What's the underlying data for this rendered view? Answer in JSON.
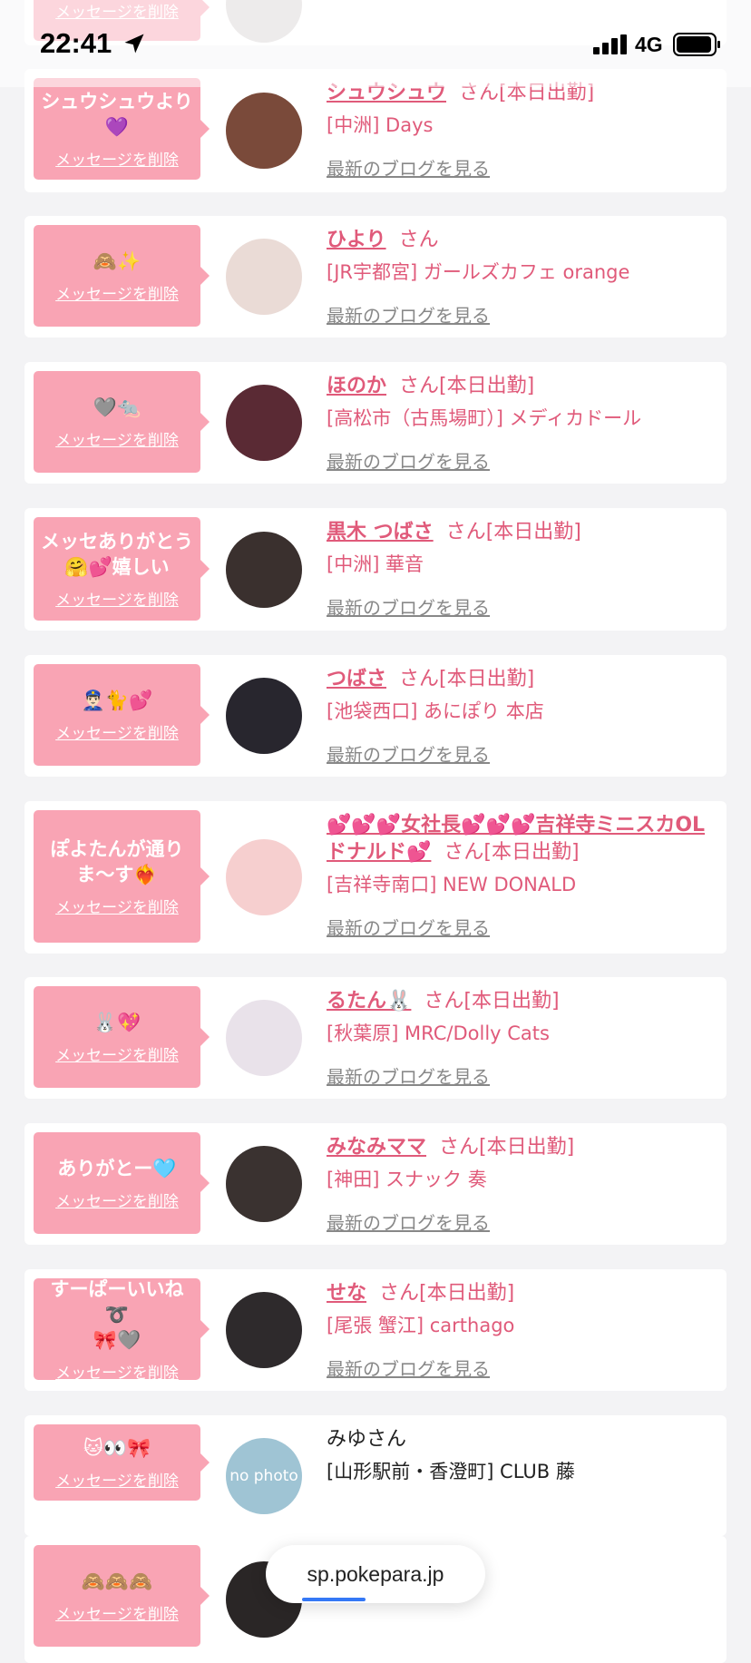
{
  "status_bar": {
    "time": "22:41",
    "network": "4G"
  },
  "common": {
    "delete_label": "メッセージを削除",
    "blog_label": "最新のブログを見る",
    "honorific": "さん"
  },
  "rows": [
    {
      "message": "",
      "name": "",
      "status": "",
      "shop": "",
      "avatar": "#d8d2d2"
    },
    {
      "message": "シュウシュウより\n💜",
      "name": "シュウシュウ",
      "status": "[本日出勤]",
      "shop": "[中洲] Days",
      "avatar": "#7a4a3a"
    },
    {
      "message": "🙈✨",
      "name": "ひより",
      "status": "",
      "shop": "[JR宇都宮] ガールズカフェ orange",
      "avatar": "#eadbd6"
    },
    {
      "message": "🩶🐀",
      "name": "ほのか",
      "status": "[本日出勤]",
      "shop": "[高松市（古馬場町）] メディカドール",
      "avatar": "#5a2a34"
    },
    {
      "message": "メッセありがとう\n🤗💕嬉しい",
      "name": "黒木 つばさ",
      "status": "[本日出勤]",
      "shop": "[中洲] 華音",
      "avatar": "#3a302e"
    },
    {
      "message": "👮🏻‍♂️🐈💕",
      "name": "つばさ",
      "status": "[本日出勤]",
      "shop": "[池袋西口] あにぽり 本店",
      "avatar": "#28262e"
    },
    {
      "message": "ぽよたんが通り\nま〜す❤️‍🔥",
      "name": "💕💕💕女社長💕💕💕吉祥寺ミニスカOLドナルド💕",
      "status": "[本日出勤]",
      "shop": "[吉祥寺南口] NEW DONALD",
      "avatar": "#f6cfcf"
    },
    {
      "message": "🐰💖",
      "name": "るたん🐰",
      "status": "[本日出勤]",
      "shop": "[秋葉原] MRC/Dolly Cats",
      "avatar": "#e9e2ea"
    },
    {
      "message": "ありがとー🩵",
      "name": "みなみママ",
      "status": "[本日出勤]",
      "shop": "[神田] スナック 奏",
      "avatar": "#3a3230"
    },
    {
      "message": "すーぱーいいね➰\n🎀🩶",
      "name": "せな",
      "status": "[本日出勤]",
      "shop": "[尾張 蟹江] carthago",
      "avatar": "#2e2a2c"
    },
    {
      "message": "🐱👀🎀",
      "name": "みゆさん",
      "status": "",
      "shop": "[山形駅前・香澄町] CLUB 藤",
      "avatar": "#9fc4d4",
      "avatar_text": "no photo"
    },
    {
      "message": "🙈🙈🙈",
      "name": "",
      "status": "",
      "shop": "",
      "avatar": "#2a2626"
    }
  ],
  "browser": {
    "url": "sp.pokepara.jp"
  }
}
